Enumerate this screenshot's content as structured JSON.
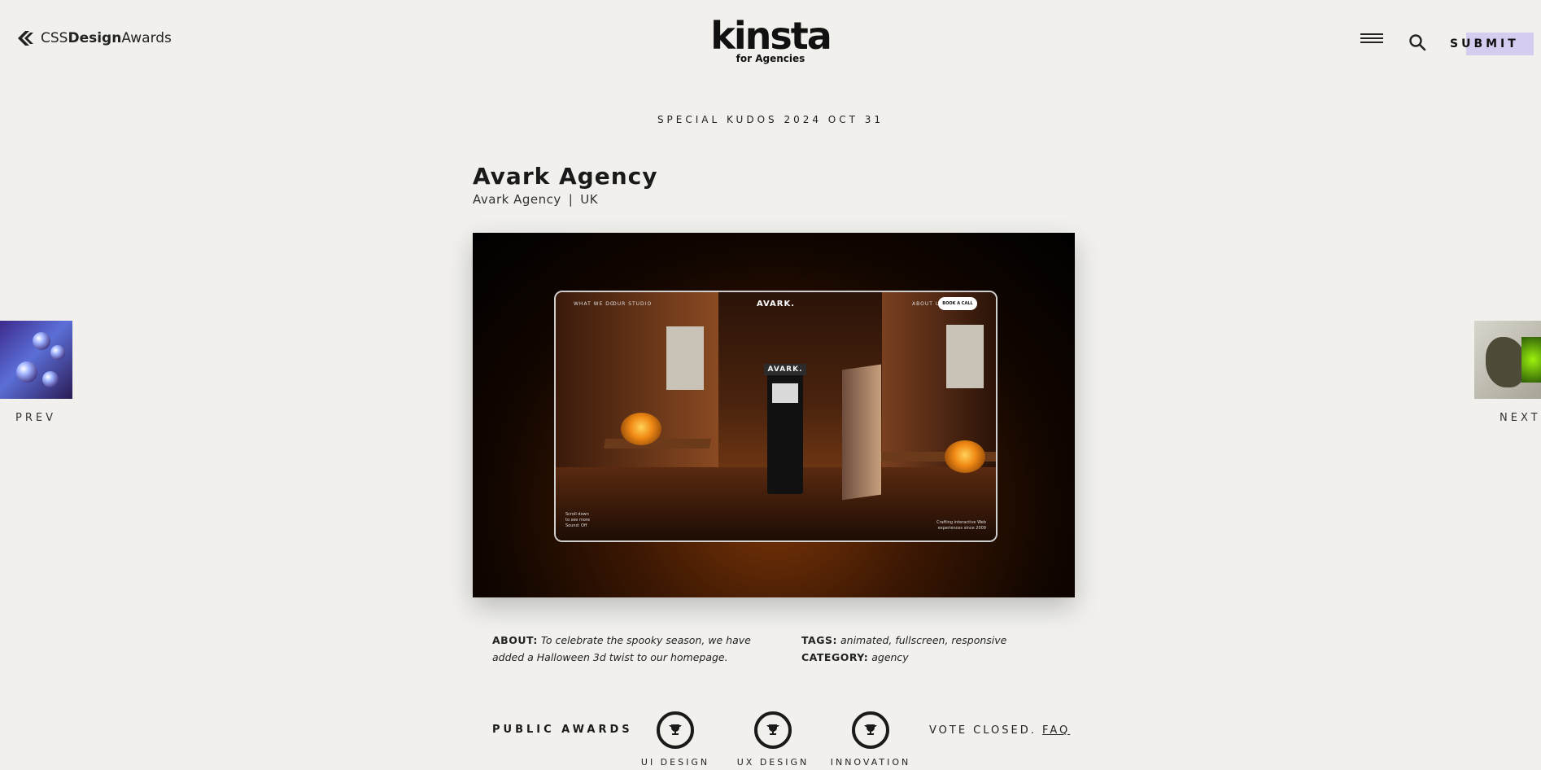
{
  "header": {
    "logo_prefix": "CSS",
    "logo_bold": "Design",
    "logo_suffix": "Awards",
    "sponsor_name": "kinsta",
    "sponsor_sub": "for Agencies",
    "menu_icon": "hamburger-icon",
    "search_icon": "search-icon",
    "submit_label": "SUBMIT",
    "submit_highlight": "#d6ccef"
  },
  "entry": {
    "date": "SPECIAL KUDOS 2024 OCT 31",
    "title": "Avark Agency",
    "author": "Avark Agency",
    "separator": "|",
    "country": "UK"
  },
  "screenshot": {
    "nav_left_1": "WHAT WE DO",
    "nav_left_2": "OUR STUDIO",
    "brand": "AVARK.",
    "nav_right": "ABOUT US",
    "cta": "BOOK A CALL",
    "arcade_brand": "AVARK.",
    "scroll_hint_1": "Scroll down",
    "scroll_hint_2": "to see more",
    "sound": "Sound: Off",
    "tagline_1": "Crafting interactive Web",
    "tagline_2": "experiences since 2009"
  },
  "nav": {
    "prev_label": "PREV",
    "next_label": "NEXT"
  },
  "about": {
    "label": "ABOUT:",
    "text": "To celebrate the spooky season, we have added a Halloween 3d twist to our homepage."
  },
  "meta": {
    "tags_label": "TAGS:",
    "tags": [
      "animated",
      "fullscreen",
      "responsive"
    ],
    "category_label": "CATEGORY:",
    "category": "agency"
  },
  "awards": {
    "label": "PUBLIC AWARDS",
    "items": [
      {
        "label": "UI DESIGN",
        "icon": "trophy-icon"
      },
      {
        "label": "UX DESIGN",
        "icon": "trophy-icon"
      },
      {
        "label": "INNOVATION",
        "icon": "trophy-icon"
      }
    ],
    "vote_text": "VOTE CLOSED.",
    "faq_label": "FAQ"
  }
}
